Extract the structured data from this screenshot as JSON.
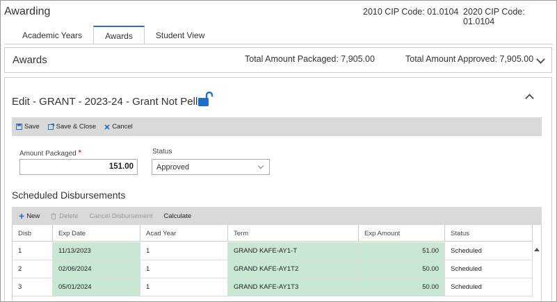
{
  "page": {
    "title": "Awarding",
    "cip_2010": "2010 CIP Code: 01.0104",
    "cip_2020": "2020 CIP Code: 01.0104"
  },
  "tabs": [
    {
      "label": "Academic Years"
    },
    {
      "label": "Awards"
    },
    {
      "label": "Student View"
    }
  ],
  "awards": {
    "title": "Awards",
    "total_packaged": "Total Amount Packaged: 7,905.00",
    "total_approved": "Total Amount Approved: 7,905.00"
  },
  "edit": {
    "title": "Edit - GRANT - 2023-24 - Grant Not Pell",
    "toolbar": {
      "save": "Save",
      "save_close": "Save & Close",
      "cancel": "Cancel"
    },
    "amount_label": "Amount Packaged",
    "required_mark": "*",
    "amount_value": "151.00",
    "status_label": "Status",
    "status_value": "Approved"
  },
  "disbursements": {
    "title": "Scheduled Disbursements",
    "toolbar": {
      "new": "New",
      "delete": "Delete",
      "cancel_disbursement": "Cancel Disbursement",
      "calculate": "Calculate"
    },
    "columns": [
      "Disb",
      "Exp Date",
      "Acad Year",
      "Term",
      "Exp Amount",
      "Status"
    ],
    "rows": [
      [
        "1",
        "11/13/2023",
        "1",
        "GRAND KAFE-AY1-T",
        "51.00",
        "Scheduled"
      ],
      [
        "2",
        "02/06/2024",
        "1",
        "GRAND KAFE-AY1T2",
        "50.00",
        "Scheduled"
      ],
      [
        "3",
        "05/01/2024",
        "1",
        "GRAND KAFE-AY1T3",
        "50.00",
        "Scheduled"
      ]
    ]
  },
  "colors": {
    "accent": "#2a6ebb",
    "toolbar_bg": "#d9d9d9",
    "editable_cell": "#c8e8d4",
    "required": "#cc0000"
  },
  "icons": [
    "unlock-icon",
    "save-icon",
    "save-close-icon",
    "cancel-icon",
    "plus-icon",
    "delete-icon",
    "chevron-down-icon",
    "chevron-up-icon"
  ]
}
